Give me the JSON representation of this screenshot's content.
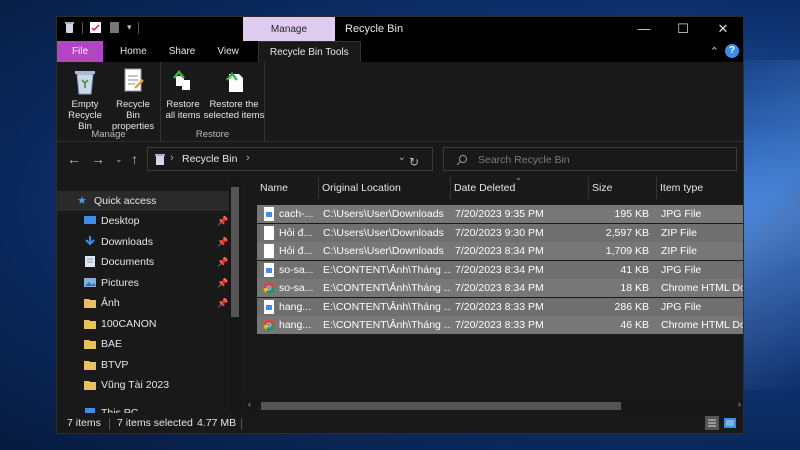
{
  "window": {
    "title": "Recycle Bin",
    "manage_tab": "Manage",
    "minimize": "—",
    "maximize": "☐",
    "close": "✕"
  },
  "ribbon_tabs": [
    "File",
    "Home",
    "Share",
    "View",
    "Recycle Bin Tools"
  ],
  "ribbon": {
    "manage_group": {
      "caption": "Manage",
      "empty_label_1": "Empty",
      "empty_label_2": "Recycle Bin",
      "props_label_1": "Recycle Bin",
      "props_label_2": "properties"
    },
    "restore_group": {
      "caption": "Restore",
      "all_label_1": "Restore",
      "all_label_2": "all items",
      "sel_label_1": "Restore the",
      "sel_label_2": "selected items"
    }
  },
  "address": {
    "breadcrumb": "Recycle Bin",
    "search_placeholder": "Search Recycle Bin"
  },
  "nav": {
    "items": [
      {
        "label": "Quick access",
        "icon": "star-icon"
      },
      {
        "label": "Desktop",
        "icon": "desktop-icon",
        "pinned": true
      },
      {
        "label": "Downloads",
        "icon": "download-icon",
        "pinned": true
      },
      {
        "label": "Documents",
        "icon": "document-icon",
        "pinned": true
      },
      {
        "label": "Pictures",
        "icon": "pictures-icon",
        "pinned": true
      },
      {
        "label": "Ảnh",
        "icon": "folder-icon",
        "pinned": true
      },
      {
        "label": "100CANON",
        "icon": "folder-icon"
      },
      {
        "label": "BAE",
        "icon": "folder-icon"
      },
      {
        "label": "BTVP",
        "icon": "folder-icon"
      },
      {
        "label": "Vũng Tài 2023",
        "icon": "folder-icon"
      },
      {
        "label": "This PC",
        "icon": "computer-icon"
      }
    ]
  },
  "columns": [
    "Name",
    "Original Location",
    "Date Deleted",
    "Size",
    "Item type"
  ],
  "files": [
    {
      "name": "cach-...",
      "location": "C:\\Users\\User\\Downloads",
      "date": "7/20/2023 9:35 PM",
      "size": "195 KB",
      "type": "JPG File",
      "icon": "image-file-icon"
    },
    {
      "name": "Hỏi đ...",
      "location": "C:\\Users\\User\\Downloads",
      "date": "7/20/2023 9:30 PM",
      "size": "2,597 KB",
      "type": "ZIP File",
      "icon": "zip-file-icon"
    },
    {
      "name": "Hỏi đ...",
      "location": "C:\\Users\\User\\Downloads",
      "date": "7/20/2023 8:34 PM",
      "size": "1,709 KB",
      "type": "ZIP File",
      "icon": "zip-file-icon"
    },
    {
      "name": "so-sa...",
      "location": "E:\\CONTENT\\Ảnh\\Tháng ...",
      "date": "7/20/2023 8:34 PM",
      "size": "41 KB",
      "type": "JPG File",
      "icon": "image-file-icon"
    },
    {
      "name": "so-sa...",
      "location": "E:\\CONTENT\\Ảnh\\Tháng ...",
      "date": "7/20/2023 8:34 PM",
      "size": "18 KB",
      "type": "Chrome HTML Do...",
      "icon": "chrome-icon"
    },
    {
      "name": "hang...",
      "location": "E:\\CONTENT\\Ảnh\\Tháng ...",
      "date": "7/20/2023 8:33 PM",
      "size": "286 KB",
      "type": "JPG File",
      "icon": "image-file-icon"
    },
    {
      "name": "hang...",
      "location": "E:\\CONTENT\\Ảnh\\Tháng ...",
      "date": "7/20/2023 8:33 PM",
      "size": "46 KB",
      "type": "Chrome HTML Do...",
      "icon": "chrome-icon"
    }
  ],
  "status": {
    "count": "7 items",
    "selected": "7 items selected",
    "size": "4.77 MB"
  },
  "colors": {
    "file_tab": "#b146c2",
    "manage_tab": "#e0ccf0",
    "selected_row": "#777777",
    "accent_blue": "#3b8eea"
  }
}
